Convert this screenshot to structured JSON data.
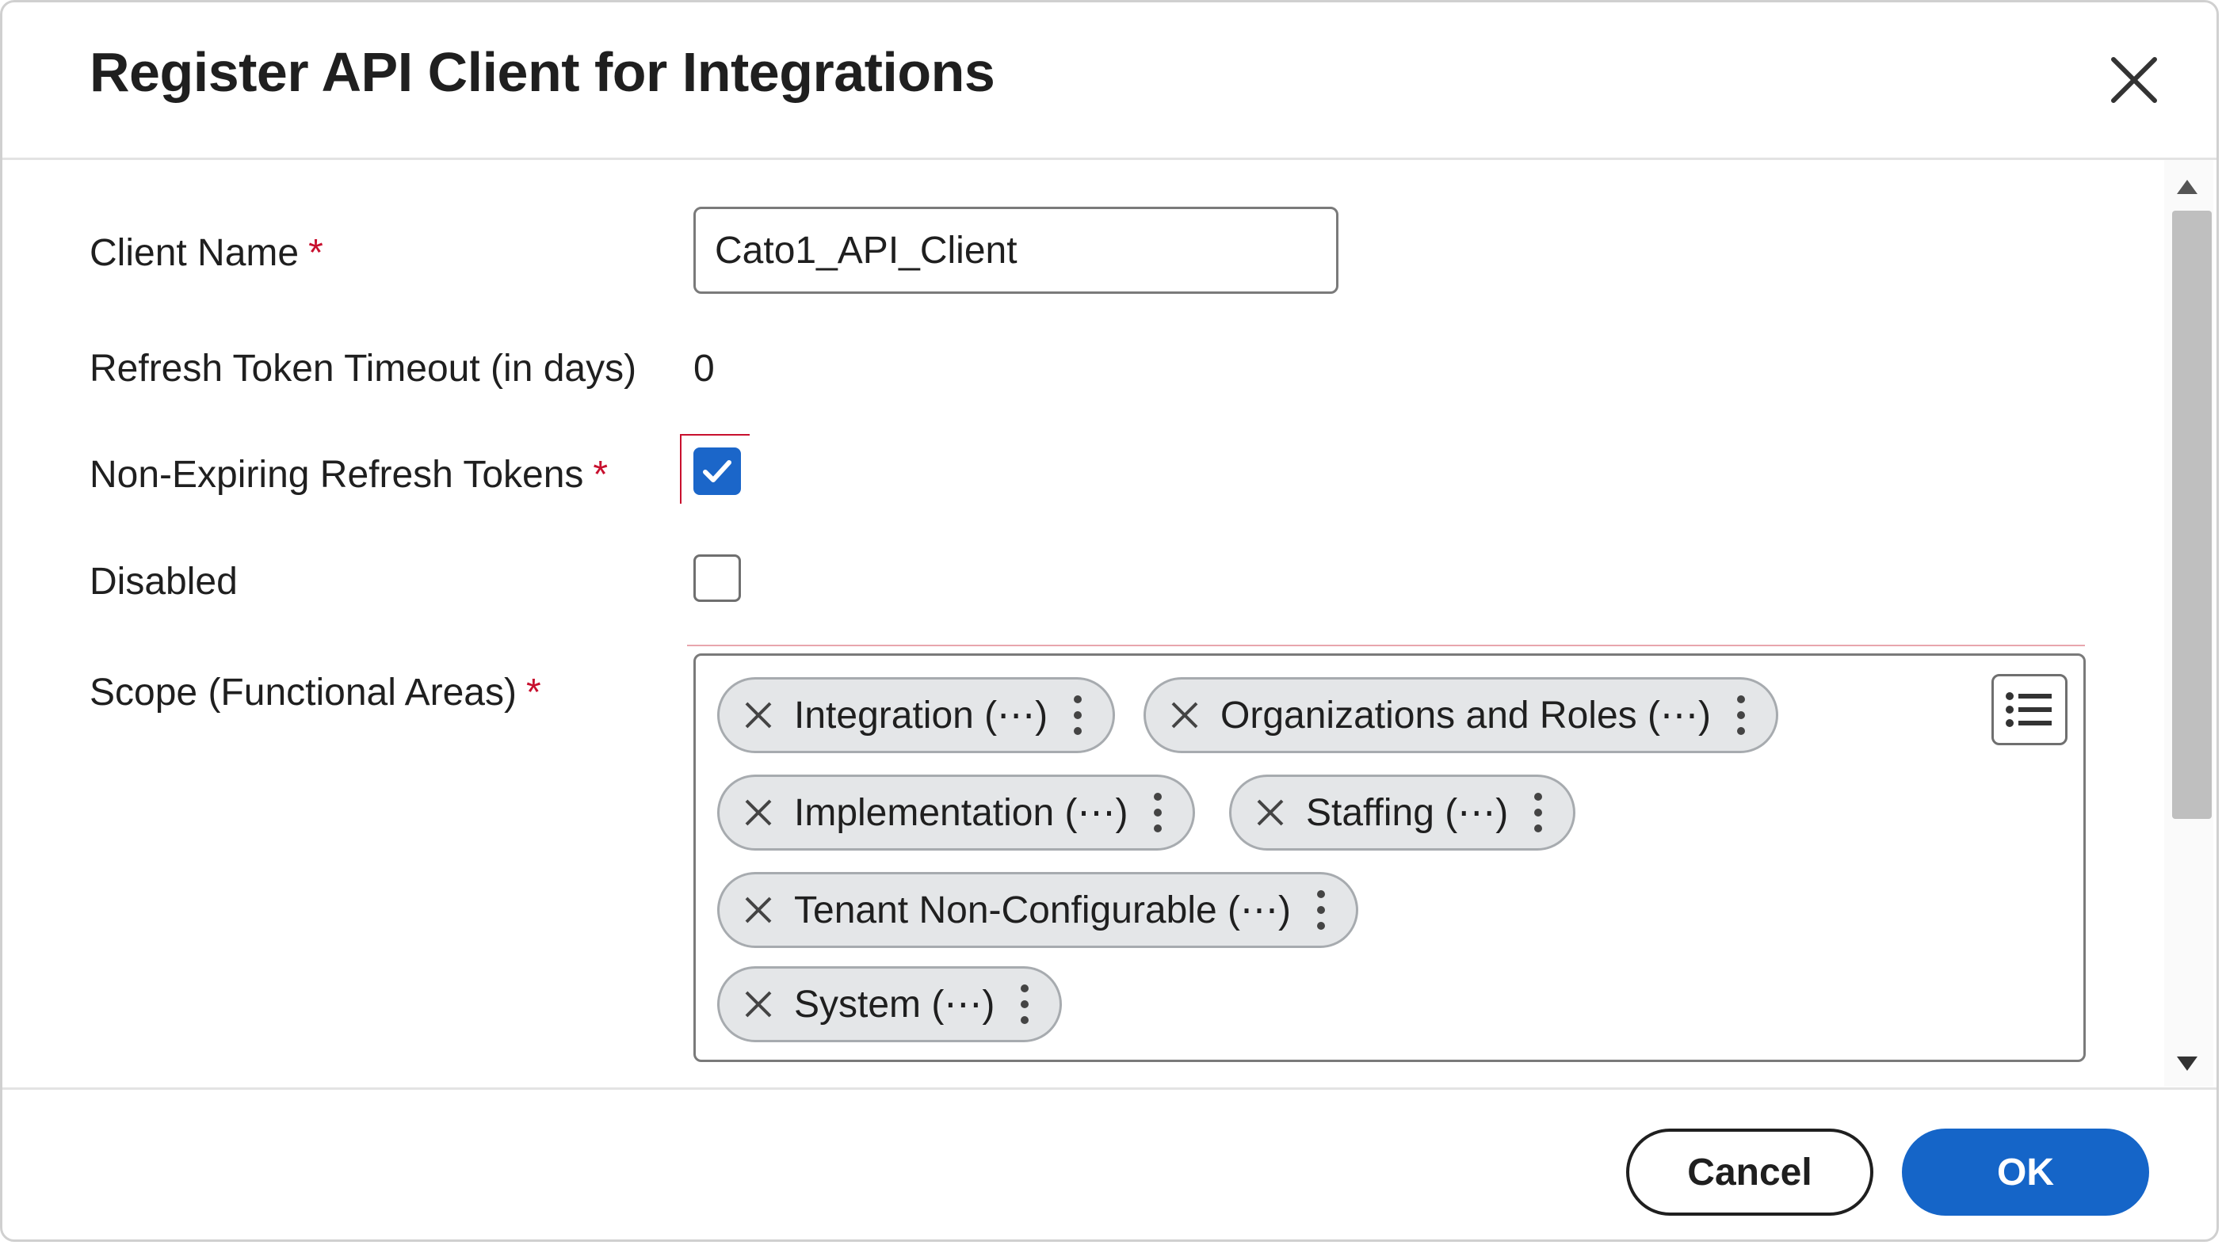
{
  "dialog": {
    "title": "Register API Client for Integrations"
  },
  "form": {
    "client_name": {
      "label": "Client Name",
      "required_mark": "*",
      "value": "Cato1_API_Client"
    },
    "refresh_timeout": {
      "label": "Refresh Token Timeout (in days)",
      "value": "0"
    },
    "non_expiring": {
      "label": "Non-Expiring Refresh Tokens",
      "required_mark": "*",
      "checked": true
    },
    "disabled": {
      "label": "Disabled",
      "checked": false
    },
    "scope": {
      "label": "Scope (Functional Areas)",
      "required_mark": "*",
      "items": [
        {
          "label": "Integration (⋯)"
        },
        {
          "label": "Organizations and Roles (⋯)"
        },
        {
          "label": "Implementation (⋯)"
        },
        {
          "label": "Staffing (⋯)"
        },
        {
          "label": "Tenant Non-Configurable (⋯)"
        },
        {
          "label": "System (⋯)"
        }
      ]
    }
  },
  "footer": {
    "cancel_label": "Cancel",
    "ok_label": "OK"
  },
  "icons": {
    "close": "close-icon",
    "checkmark": "checkmark-icon",
    "remove": "remove-x-icon",
    "more": "more-vertical-icon",
    "list": "list-icon",
    "scroll_up": "triangle-up-icon",
    "scroll_down": "triangle-down-icon"
  },
  "colors": {
    "primary": "#1565c8",
    "checkbox_checked": "#1b66c9",
    "required": "#c8102e",
    "pill_bg": "#e4e6e8"
  }
}
